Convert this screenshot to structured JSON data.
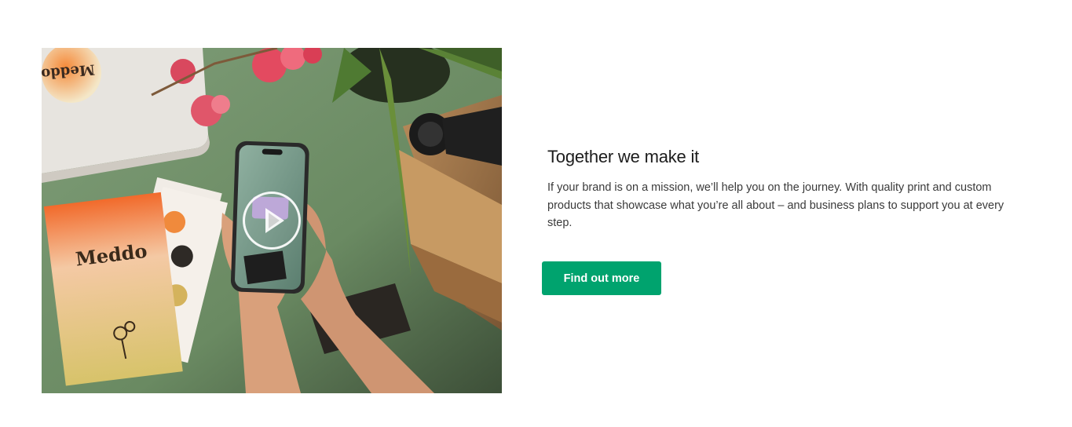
{
  "feature": {
    "title": "Together we make it",
    "description": "If your brand is on a mission, we’ll help you on the journey. With quality print and custom products that showcase what you’re all about – and business plans to support you at every step.",
    "cta_label": "Find out more"
  },
  "media": {
    "brand_lettering": "Meddo",
    "play_icon": "play-icon"
  },
  "colors": {
    "cta_background": "#00a36e",
    "cta_text": "#ffffff",
    "page_background": "#ffffff"
  }
}
